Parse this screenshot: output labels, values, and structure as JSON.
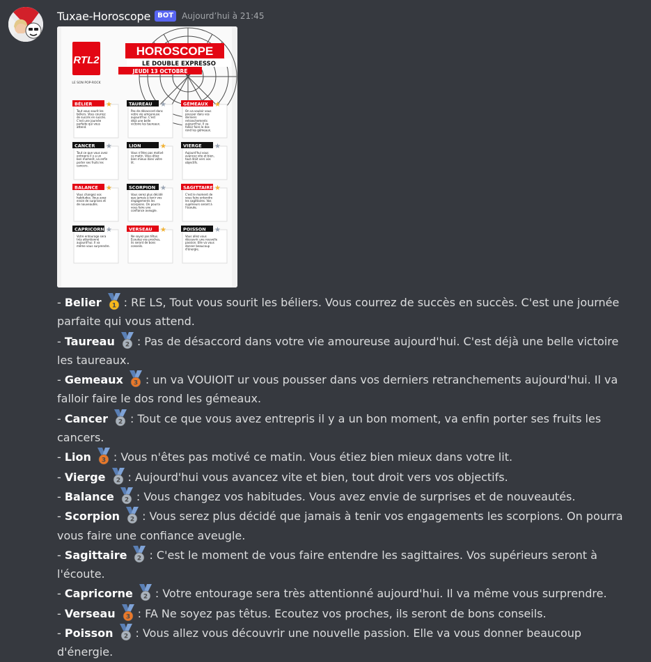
{
  "message": {
    "username": "Tuxae-Horoscope",
    "bot_tag": "BOT",
    "timestamp": "Aujourd’hui à 21:45"
  },
  "poster": {
    "brand": "RTL2",
    "slogan": "LE SON POP-ROCK",
    "title": "HOROSCOPE",
    "subtitle": "LE DOUBLE EXPRESSO",
    "date": "JEUDI 13 OCTOBRE",
    "cards": [
      {
        "name": "BÉLIER",
        "text": "Tout vous sourit les béliers. Vous courrez de succès en succès. C'est une journée parfaite qui vous attend."
      },
      {
        "name": "TAUREAU",
        "text": "Pas de désaccord dans votre vie amoureuse aujourd'hui. C'est déjà une belle victoire les taureaux."
      },
      {
        "name": "GÉMEAUX",
        "text": "On va vouloir vous pousser dans vos derniers retranchements aujourd'hui. Il va falloir faire le dos rond les gémeaux."
      },
      {
        "name": "CANCER",
        "text": "Tout ce que vous avez entrepris il y a un bon moment, va enfin porter ses fruits les cancers."
      },
      {
        "name": "LION",
        "text": "Vous n'êtes pas motivé ce matin. Vous étiez bien mieux dans votre lit."
      },
      {
        "name": "VIERGE",
        "text": "Aujourd'hui vous avancez vite et bien, tout droit vers vos objectifs."
      },
      {
        "name": "BALANCE",
        "text": "Vous changez vos habitudes. Vous avez envie de surprises et de nouveautés."
      },
      {
        "name": "SCORPION",
        "text": "Vous serez plus décidé que jamais à tenir vos engagements les scorpions. On pourra vous faire une confiance aveugle."
      },
      {
        "name": "SAGITTAIRE",
        "text": "C'est le moment de vous faire entendre les sagittaires. Vos supérieurs seront à l'écoute."
      },
      {
        "name": "CAPRICORNE",
        "text": "Votre entourage sera très attentionné aujourd'hui. Il va même vous surprendre."
      },
      {
        "name": "VERSEAU",
        "text": "Ne soyez pas têtus. Ecoutez vos proches, ils seront de bons conseils."
      },
      {
        "name": "POISSON",
        "text": "Vous allez vous découvrir une nouvelle passion. Elle va vous donner beaucoup d'énergie."
      }
    ]
  },
  "entries": [
    {
      "prefix": "- ",
      "sign": "Belier",
      "medal": "1",
      "text": ": RE LS, Tout vous sourit les béliers. Vous courrez de succès en succès. C'est une journée parfaite qui vous attend."
    },
    {
      "prefix": "- ",
      "sign": "Taureau",
      "medal": "2",
      "text": ": Pas de désaccord dans votre vie amoureuse aujourd'hui. C'est déjà une belle victoire les taureaux."
    },
    {
      "prefix": "- ",
      "sign": "Gemeaux",
      "medal": "3",
      "text": ": un va VOUIOIT ur vous pousser dans vos derniers retranchements aujourd'hui. Il va falloir faire le dos rond les gémeaux."
    },
    {
      "prefix": "- ",
      "sign": "Cancer",
      "medal": "2",
      "text": ": Tout ce que vous avez entrepris il y a un bon moment, va enfin porter ses fruits les cancers."
    },
    {
      "prefix": "- ",
      "sign": "Lion",
      "medal": "3",
      "text": ": Vous n'êtes pas motivé ce matin. Vous étiez bien mieux dans votre lit."
    },
    {
      "prefix": "- ",
      "sign": "Vierge",
      "medal": "2",
      "text": ": Aujourd'hui vous avancez vite et bien, tout droit vers vos objectifs."
    },
    {
      "prefix": "- ",
      "sign": "Balance",
      "medal": "2",
      "text": ": Vous changez vos habitudes. Vous avez envie de surprises et de nouveautés."
    },
    {
      "prefix": "- ",
      "sign": "Scorpion",
      "medal": "2",
      "text": ": Vous serez plus décidé que jamais à tenir vos engagements les scorpions. On pourra vous faire une confiance aveugle."
    },
    {
      "prefix": "- ",
      "sign": "Sagittaire",
      "medal": "2",
      "text": ": C'est le moment de vous faire entendre les sagittaires. Vos supérieurs seront à l'écoute."
    },
    {
      "prefix": "- ",
      "sign": "Capricorne",
      "medal": "2",
      "text": ": Votre entourage sera très attentionné aujourd'hui. Il va même vous surprendre."
    },
    {
      "prefix": "- ",
      "sign": "Verseau",
      "medal": "3",
      "text": ": FA Ne soyez pas têtus. Ecoutez vos proches, ils seront de bons conseils."
    },
    {
      "prefix": "- ",
      "sign": "Poisson",
      "medal": "2",
      "text": ": Vous allez vous découvrir une nouvelle passion.  Elle va vous donner beaucoup d'énergie."
    }
  ],
  "colors": {
    "background": "#36393f",
    "text": "#dcddde",
    "username": "#ffffff",
    "bot_tag": "#5865f2",
    "timestamp": "#a3a6aa",
    "rtl2_red": "#e30613",
    "medal_ribbon": "#5a7fb5",
    "medal_gold": "#f6b81c",
    "medal_silver": "#a9b2bc",
    "medal_bronze": "#e8782a"
  },
  "icons": {
    "medal_1": "first-place-medal-icon",
    "medal_2": "second-place-medal-icon",
    "medal_3": "third-place-medal-icon"
  }
}
